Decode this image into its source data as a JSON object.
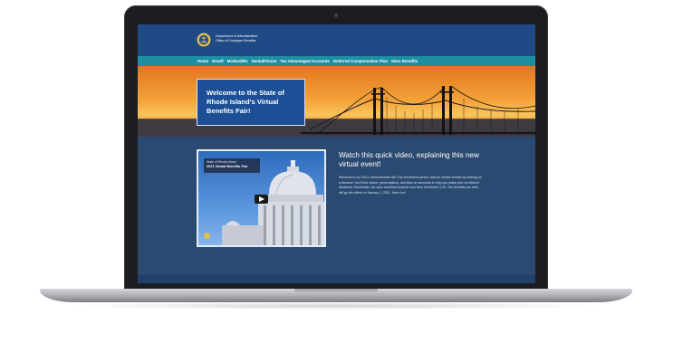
{
  "header": {
    "department_line1": "Department of Administration",
    "department_line2": "Office of Employee Benefits"
  },
  "nav": {
    "items": [
      "Home",
      "Enroll",
      "Medical/Rx",
      "Dental/Vision",
      "Tax Advantaged Accounts",
      "Deferred Compensation Plan",
      "More Benefits"
    ]
  },
  "hero": {
    "title": "Welcome to the State of Rhode Island's Virtual Benefits Fair!"
  },
  "video": {
    "caption_small": "State of Rhode Island",
    "caption_big": "2021 Virtual Benefits Fair"
  },
  "watch": {
    "heading": "Watch this quick video, explaining this new virtual event!",
    "body": "Welcome to our 2021 virtual benefits fair! The enrollment period, visit our vendor booths by clicking on a Barstow. You'll find videos, presentations, and links to resources to help you make your enrollment decisions. Remember, the open enrollment period runs from November 2-20. The benefits you elect will go into effect on January 1, 2021. Have fun!"
  },
  "colors": {
    "header_blue": "#1f4a85",
    "nav_teal": "#1e8ea3",
    "hero_orange": "#f4a23a",
    "content_navy": "#2b4a71"
  }
}
